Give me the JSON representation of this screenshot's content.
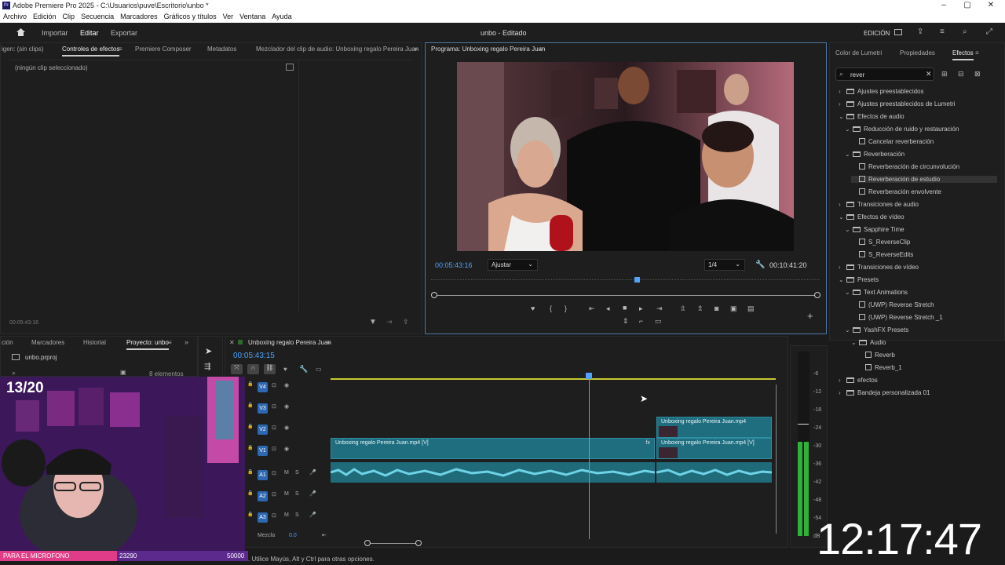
{
  "window": {
    "title": "Adobe Premiere Pro 2025 - C:\\Usuarios\\puve\\Escritorio\\unbo *",
    "app_icon": "Pr"
  },
  "menu": [
    "Archivo",
    "Edición",
    "Clip",
    "Secuencia",
    "Marcadores",
    "Gráficos y títulos",
    "Ver",
    "Ventana",
    "Ayuda"
  ],
  "header": {
    "nav": [
      "Importar",
      "Editar",
      "Exportar"
    ],
    "project_title": "unbo - Editado",
    "workspace": "EDICIÓN"
  },
  "source_panel": {
    "tabs": [
      "igen: (sin clips)",
      "Controles de efectos",
      "Premiere Composer",
      "Metadatos",
      "Mezclador del clip de audio: Unboxing regalo Pereira Juan"
    ],
    "empty_text": "(ningún clip seleccionado)",
    "timecode": "00:05:43:16"
  },
  "program_panel": {
    "tab": "Programa: Unboxing regalo Pereira Juan",
    "timecode": "00:05:43:16",
    "fit": "Ajustar",
    "quality": "1/4",
    "duration": "00:10:41:20",
    "playhead_fraction": 0.53
  },
  "right_panel": {
    "tabs": [
      "Color de Lumetri",
      "Propiedades",
      "Efectos"
    ],
    "search": "rever",
    "tree": [
      {
        "depth": 0,
        "type": "folder",
        "open": false,
        "label": "Ajustes preestablecidos"
      },
      {
        "depth": 0,
        "type": "folder",
        "open": false,
        "label": "Ajustes preestablecidos de Lumetri"
      },
      {
        "depth": 0,
        "type": "folder",
        "open": true,
        "label": "Efectos de audio"
      },
      {
        "depth": 1,
        "type": "folder",
        "open": true,
        "label": "Reducción de ruido y restauración"
      },
      {
        "depth": 2,
        "type": "file",
        "label": "Cancelar reverberación"
      },
      {
        "depth": 1,
        "type": "folder",
        "open": true,
        "label": "Reverberación"
      },
      {
        "depth": 2,
        "type": "file",
        "label": "Reverberación de circunvolución"
      },
      {
        "depth": 2,
        "type": "file",
        "label": "Reverberación de estudio",
        "selected": true
      },
      {
        "depth": 2,
        "type": "file",
        "label": "Reverberación envolvente"
      },
      {
        "depth": 0,
        "type": "folder",
        "open": false,
        "label": "Transiciones de audio"
      },
      {
        "depth": 0,
        "type": "folder",
        "open": true,
        "label": "Efectos de vídeo"
      },
      {
        "depth": 1,
        "type": "folder",
        "open": true,
        "label": "Sapphire Time"
      },
      {
        "depth": 2,
        "type": "file",
        "label": "S_ReverseClip"
      },
      {
        "depth": 2,
        "type": "file",
        "label": "S_ReverseEdits"
      },
      {
        "depth": 0,
        "type": "folder",
        "open": false,
        "label": "Transiciones de vídeo"
      },
      {
        "depth": 0,
        "type": "folder",
        "open": true,
        "label": "Presets"
      },
      {
        "depth": 1,
        "type": "folder",
        "open": true,
        "label": "Text Animations"
      },
      {
        "depth": 2,
        "type": "file",
        "label": "(UWP) Reverse Stretch"
      },
      {
        "depth": 2,
        "type": "file",
        "label": "(UWP) Reverse Stretch _1"
      },
      {
        "depth": 1,
        "type": "folder",
        "open": true,
        "label": "YashFX Presets"
      },
      {
        "depth": 2,
        "type": "folder",
        "open": true,
        "label": "Audio"
      },
      {
        "depth": 3,
        "type": "file",
        "label": "Reverb"
      },
      {
        "depth": 3,
        "type": "file",
        "label": "Reverb_1"
      },
      {
        "depth": 0,
        "type": "folder",
        "open": false,
        "label": "efectos"
      },
      {
        "depth": 0,
        "type": "folder",
        "open": false,
        "label": "Bandeja personalizada 01"
      }
    ]
  },
  "project_panel": {
    "tabs": [
      "ción",
      "Marcadores",
      "Historial",
      "Proyecto: unbo"
    ],
    "file": "unbo.prproj",
    "count": "8 elementos"
  },
  "timeline": {
    "tab": "Unboxing regalo Pereira Juan",
    "timecode": "00:05:43:15",
    "tracks": [
      "V4",
      "V3",
      "V2",
      "V1",
      "A1",
      "A2",
      "A3"
    ],
    "mix_label": "Mezcla",
    "mix_value": "0.0",
    "clips": {
      "v1_main": "Unboxing regalo Pereira Juan.mp4 [V]",
      "v1_second": "Unboxing regalo Pereira Juan.mp4 [V]",
      "v2": "Unboxing regalo Pereira Juan.mp4"
    },
    "playhead_fraction": 0.58
  },
  "meter": {
    "labels": [
      "-6",
      "-12",
      "-18",
      "-24",
      "-30",
      "-36",
      "-42",
      "-48",
      "-54",
      "dB"
    ]
  },
  "overlay": {
    "counter": "13/20",
    "clock": "12:17:47",
    "goal_label": "PARA EL MICROFONO",
    "goal_current": "23290",
    "goal_target": "50000",
    "goal_fraction": 0.47
  },
  "status": {
    "text": ". Utilice Mayús, Alt y Ctrl para otras opciones."
  }
}
